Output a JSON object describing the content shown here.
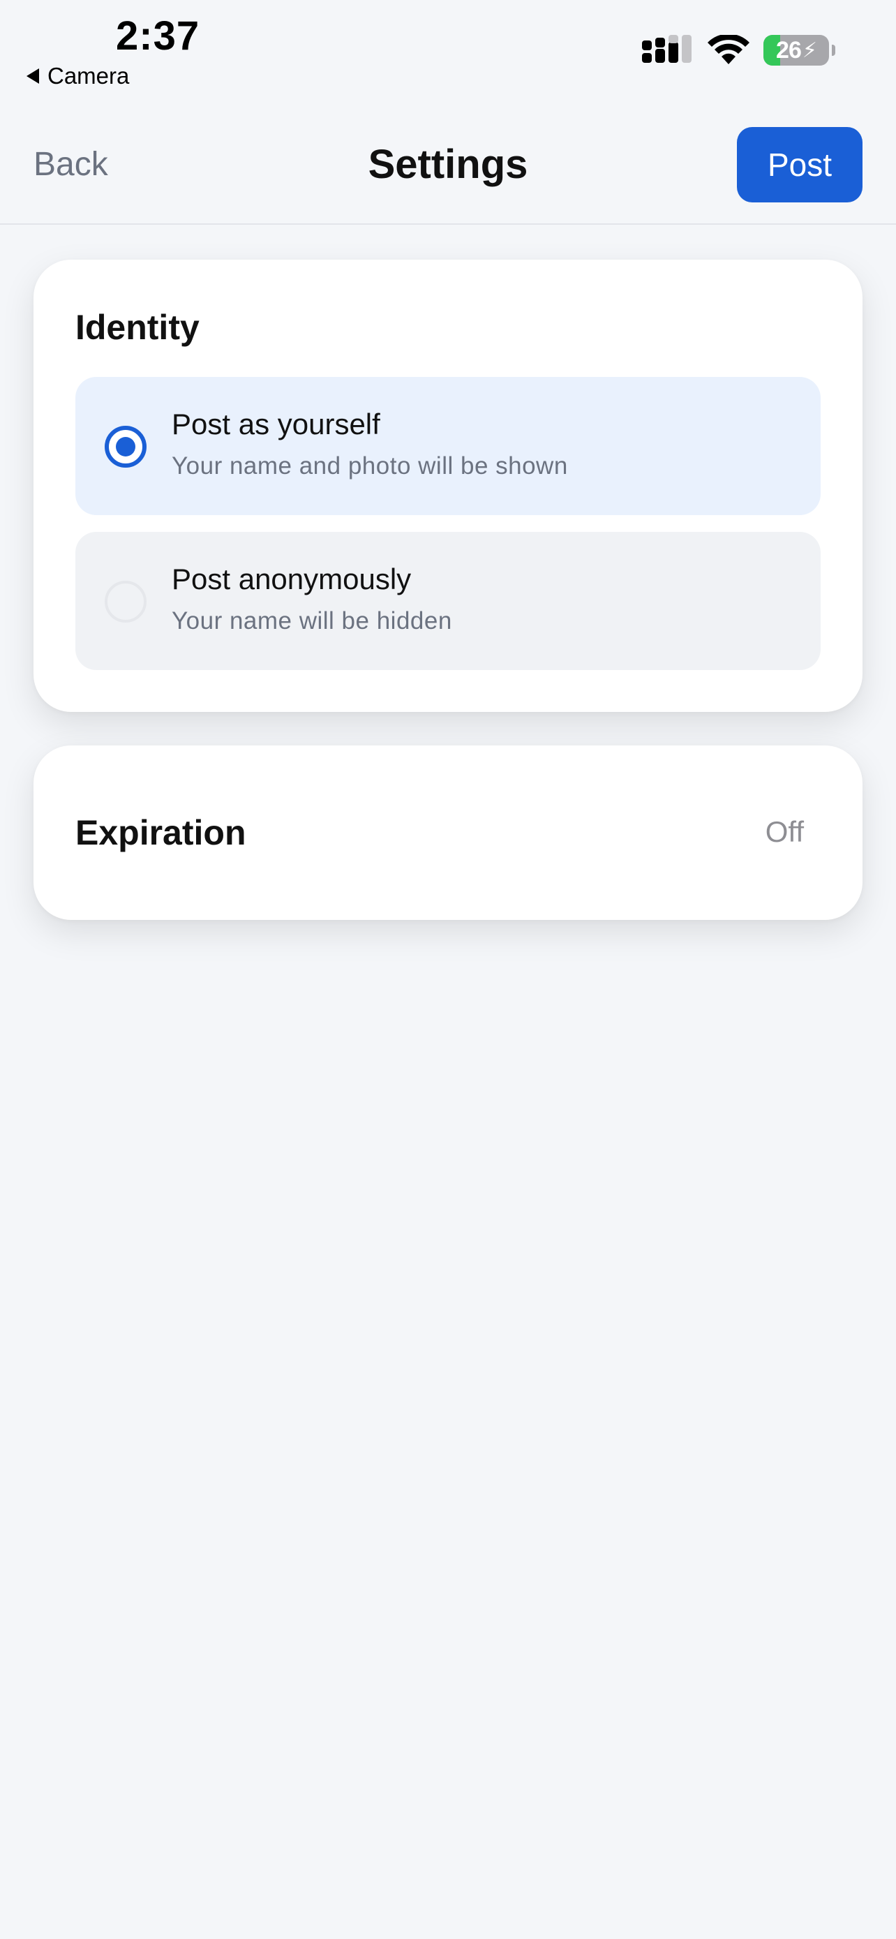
{
  "status_bar": {
    "time": "2:37",
    "back_app_label": "Camera",
    "battery_level": "26",
    "battery_percent": 26,
    "battery_color": "#34c759",
    "icons": [
      "cellular-signal-icon",
      "wifi-icon",
      "battery-charging-icon"
    ]
  },
  "nav": {
    "back_label": "Back",
    "title": "Settings",
    "post_label": "Post"
  },
  "identity": {
    "title": "Identity",
    "options": [
      {
        "title": "Post as yourself",
        "subtitle": "Your name and photo will be shown",
        "selected": true
      },
      {
        "title": "Post anonymously",
        "subtitle": "Your name will be hidden",
        "selected": false
      }
    ]
  },
  "expiration": {
    "label": "Expiration",
    "value": "Off"
  },
  "colors": {
    "accent": "#1a5fd6",
    "selected_bg": "#e9f1fd",
    "unselected_bg": "#f0f2f5",
    "page_bg": "#f4f6f9"
  }
}
